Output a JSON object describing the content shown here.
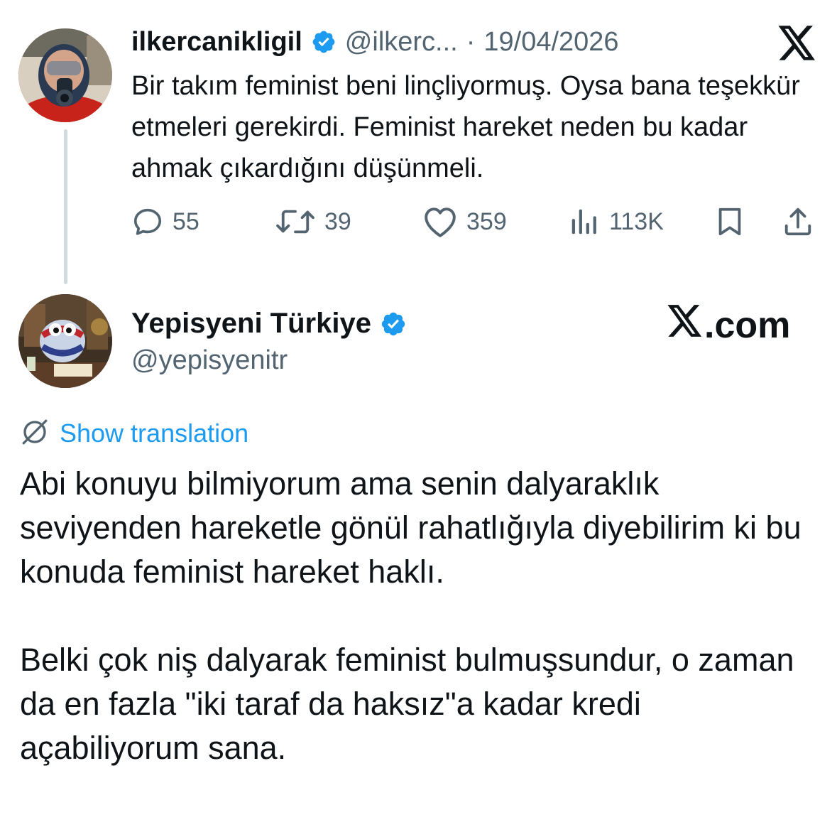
{
  "tweet1": {
    "display_name": "ilkercanikligil",
    "handle": "@ilkerc...",
    "separator": "·",
    "date": "19/04/2026",
    "text": "Bir takım feminist beni linçliyormuş. Oysa bana teşekkür etmeleri gerekirdi. Feminist hareket neden bu kadar ahmak çıkardığını düşünmeli.",
    "actions": {
      "replies": "55",
      "reposts": "39",
      "likes": "359",
      "views": "113K"
    }
  },
  "tweet2": {
    "display_name": "Yepisyeni Türkiye",
    "handle": "@yepisyenitr",
    "watermark": ".com",
    "show_translation": "Show translation",
    "paragraphs": [
      "Abi konuyu bilmiyorum ama senin dalyaraklık seviyenden hareketle gönül rahatlığıyla diyebilirim ki bu konuda feminist hareket haklı.",
      "Belki çok niş dalyarak feminist bulmuşsundur, o zaman da en fazla \"iki taraf da haksız\"a kadar kredi açabiliyorum sana."
    ]
  },
  "colors": {
    "text": "#0f1419",
    "secondary": "#536471",
    "link": "#1d9bf0",
    "verified": "#1d9bf0",
    "thread_line": "#cfd9de"
  },
  "icons": [
    "verified-badge-icon",
    "x-logo-icon",
    "reply-icon",
    "repost-icon",
    "like-icon",
    "views-icon",
    "bookmark-icon",
    "share-icon",
    "translate-icon"
  ]
}
